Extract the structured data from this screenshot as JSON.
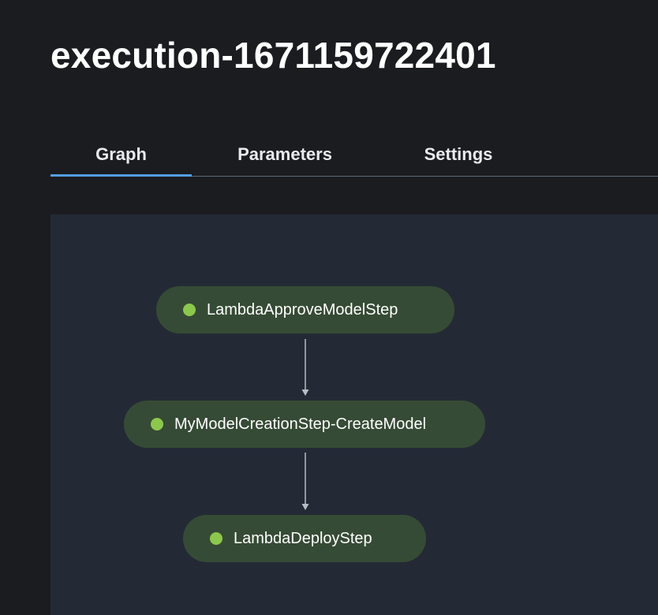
{
  "execution": {
    "title": "execution-1671159722401"
  },
  "tabs": [
    {
      "label": "Graph",
      "active": true
    },
    {
      "label": "Parameters",
      "active": false
    },
    {
      "label": "Settings",
      "active": false
    }
  ],
  "graph": {
    "nodes": [
      {
        "label": "LambdaApproveModelStep",
        "status_color": "#8cc84b"
      },
      {
        "label": "MyModelCreationStep-CreateModel",
        "status_color": "#8cc84b"
      },
      {
        "label": "LambdaDeployStep",
        "status_color": "#8cc84b"
      }
    ]
  },
  "colors": {
    "background": "#1b1c20",
    "canvas": "#232a35",
    "node_fill": "#364b35",
    "status_success": "#8cc84b",
    "tab_indicator": "#539fe5"
  }
}
